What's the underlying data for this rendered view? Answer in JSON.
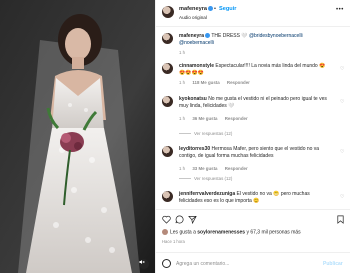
{
  "post": {
    "username": "mafeneyra",
    "follow_label": "Seguir",
    "audio": "Audio original",
    "more_icon": "more-horizontal-icon"
  },
  "caption": {
    "username": "mafeneyra",
    "text": "THE DRESS 🤍",
    "mention1": "@bridesbynoebernacelli",
    "mention2": "@noebernacelli",
    "time": "1 h"
  },
  "comments": [
    {
      "username": "cinnamonstyle",
      "text": "Espectacular!!!! La novia más linda del mundo 😍😍😍😍😍",
      "time": "1 h",
      "likes": "118 Me gusta",
      "reply": "Responder"
    },
    {
      "username": "kyokonatsu",
      "text": "No me gusta el vestido ni el peinado pero igual te ves muy linda, felicidades 🤍",
      "time": "1 h",
      "likes": "36 Me gusta",
      "reply": "Responder",
      "replies": "Ver respuestas (12)"
    },
    {
      "username": "leyditorres30",
      "text": "Hermosa Mafer, pero siento que el vestido no va contigo, de igual forma muchas felicidades",
      "time": "1 h",
      "likes": "33 Me gusta",
      "reply": "Responder",
      "replies": "Ver respuestas (12)"
    },
    {
      "username": "jenniferrvalverdezuniga",
      "text": "El vestido no va 😬 pero muchas felicidades eso es lo que importa 😊",
      "time": "1 h",
      "likes": "24 Me gusta",
      "reply": "Responder"
    }
  ],
  "actions": {
    "likes_prefix": "Les gusta a",
    "likes_user": "soylorenamenesses",
    "likes_suffix": "y 67,3 mil personas más",
    "posted": "Hace 1 hora",
    "add_comment_placeholder": "Agrega un comentario...",
    "publish_label": "Publicar"
  }
}
